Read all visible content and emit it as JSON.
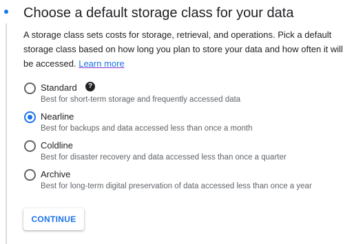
{
  "step": {
    "title": "Choose a default storage class for your data",
    "description": "A storage class sets costs for storage, retrieval, and operations. Pick a default storage class based on how long you plan to store your data and how often it will be accessed. ",
    "learn_more_label": "Learn more"
  },
  "storage_classes": [
    {
      "label": "Standard",
      "help": "Best for short-term storage and frequently accessed data",
      "selected": false
    },
    {
      "label": "Nearline",
      "help": "Best for backups and data accessed less than once a month",
      "selected": true
    },
    {
      "label": "Coldline",
      "help": "Best for disaster recovery and data accessed less than once a quarter",
      "selected": false
    },
    {
      "label": "Archive",
      "help": "Best for long-term digital preservation of data accessed less than once a year",
      "selected": false
    }
  ],
  "help_icon": {
    "name": "help-circle-icon",
    "glyph": "?"
  },
  "continue_label": "CONTINUE",
  "colors": {
    "accent": "#1a73e8",
    "text": "#202124",
    "secondary_text": "#5f6368",
    "link_underline": "#8430ce"
  }
}
